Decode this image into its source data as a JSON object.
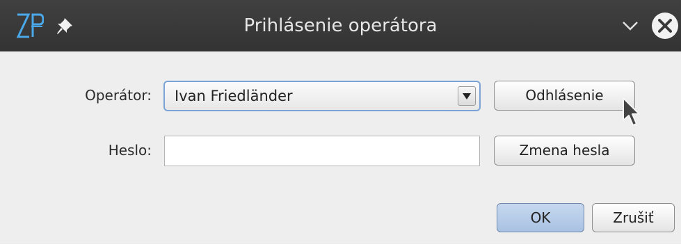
{
  "window": {
    "title": "Prihlásenie operátora",
    "logo_text": "ZP"
  },
  "form": {
    "operator_label": "Operátor:",
    "operator_value": "Ivan Friedländer",
    "password_label": "Heslo:",
    "password_value": ""
  },
  "buttons": {
    "logout": "Odhlásenie",
    "change_password": "Zmena hesla",
    "ok": "OK",
    "cancel": "Zrušiť"
  },
  "colors": {
    "titlebar": "#333333",
    "dialog_bg": "#eeeeee",
    "combo_focus_border": "#7ba4d6",
    "ok_button": "#b5cbe7",
    "logo_blue": "#4aa8e8"
  },
  "icons": {
    "logo": "zp-logo-icon",
    "pin": "pin-icon",
    "minimize": "chevron-down-icon",
    "close": "close-circle-icon",
    "dropdown": "triangle-down-icon",
    "pointer": "mouse-cursor-icon"
  }
}
